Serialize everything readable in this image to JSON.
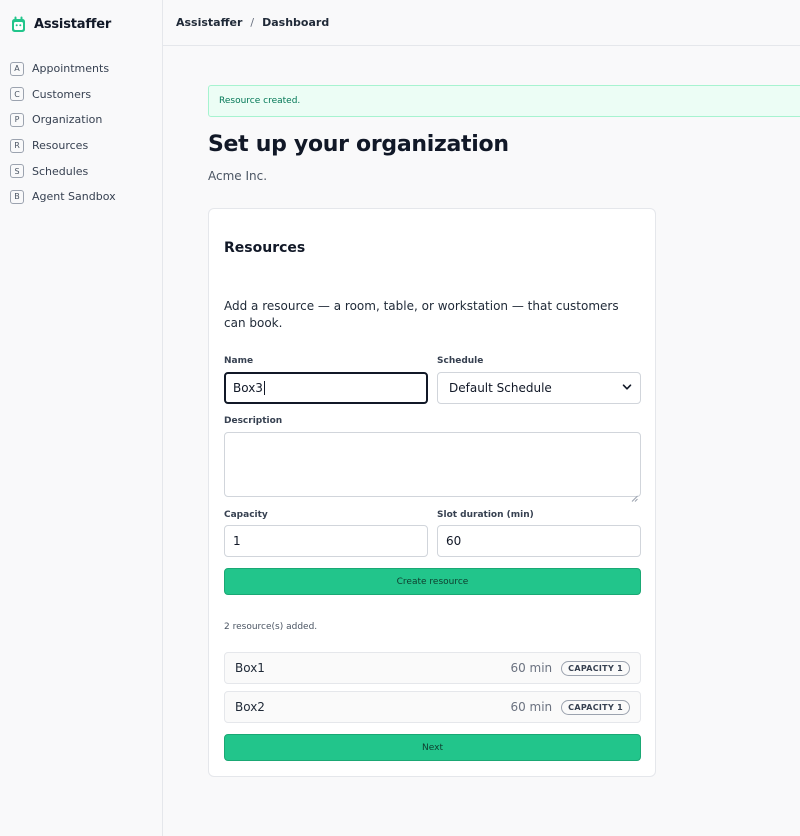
{
  "app": {
    "name": "Assistaffer"
  },
  "sidebar": {
    "items": [
      {
        "key": "A",
        "label": "Appointments"
      },
      {
        "key": "C",
        "label": "Customers"
      },
      {
        "key": "P",
        "label": "Organization"
      },
      {
        "key": "R",
        "label": "Resources"
      },
      {
        "key": "S",
        "label": "Schedules"
      },
      {
        "key": "B",
        "label": "Agent Sandbox"
      }
    ]
  },
  "breadcrumb": {
    "root": "Assistaffer",
    "separator": "/",
    "current": "Dashboard"
  },
  "alert": {
    "text": "Resource created."
  },
  "page": {
    "title": "Set up your organization",
    "org_name": "Acme Inc."
  },
  "card": {
    "title": "Resources",
    "description": "Add a resource — a room, table, or workstation — that customers can book.",
    "form": {
      "name_label": "Name",
      "name_value": "Box3",
      "schedule_label": "Schedule",
      "schedule_value": "Default Schedule",
      "description_label": "Description",
      "description_value": "",
      "capacity_label": "Capacity",
      "capacity_value": "1",
      "slot_label": "Slot duration (min)",
      "slot_value": "60",
      "create_button": "Create resource"
    },
    "count_text": "2 resource(s) added.",
    "resources": [
      {
        "name": "Box1",
        "slot": "60 min",
        "badge": "CAPACITY 1"
      },
      {
        "name": "Box2",
        "slot": "60 min",
        "badge": "CAPACITY 1"
      }
    ],
    "next_button": "Next"
  },
  "colors": {
    "accent": "#22c58b",
    "alert_bg": "#ecfdf5",
    "alert_text": "#047857"
  }
}
